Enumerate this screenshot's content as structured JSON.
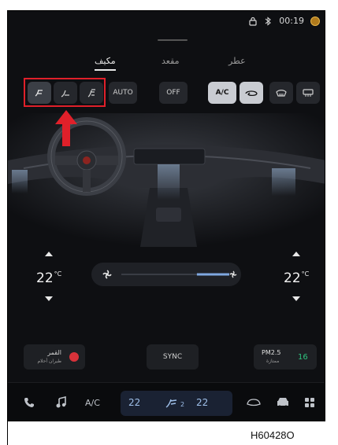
{
  "status_bar": {
    "time": "00:19",
    "icons": [
      "lock-icon",
      "bluetooth-icon",
      "brand-badge-icon"
    ]
  },
  "tabs": [
    {
      "label": "مكيف",
      "active": true
    },
    {
      "label": "مقعد",
      "active": false
    },
    {
      "label": "عطر",
      "active": false
    }
  ],
  "controls": {
    "airflow_modes": [
      "face-feet-airflow-icon",
      "feet-airflow-icon",
      "defrost-feet-airflow-icon"
    ],
    "auto_label": "AUTO",
    "off_label": "OFF",
    "ac_label": "A/C",
    "right_icons": [
      "recirculation-icon",
      "front-defrost-icon",
      "rear-defrost-icon"
    ]
  },
  "left_zone": {
    "temp": "22",
    "unit": "°C"
  },
  "right_zone": {
    "temp": "22",
    "unit": "°C"
  },
  "fan": {
    "level": 0.3
  },
  "chips": {
    "fragrance": {
      "title": "القمر",
      "subtitle": "طيران أحلام"
    },
    "sync_label": "SYNC",
    "pm25": {
      "label": "PM2.5",
      "sub": "ممتازة",
      "value": "16"
    }
  },
  "dock": {
    "ac_label": "A/C",
    "left_temp": "22",
    "right_temp": "22",
    "fan_level": "2",
    "icons": [
      "phone-icon",
      "music-icon",
      "car-icon",
      "vehicle-icon",
      "apps-icon"
    ]
  },
  "figure_code": "H60428O",
  "colors": {
    "highlight": "#e0202a",
    "accent": "#2ec27e",
    "fan_fill": "#7fa8e0"
  }
}
